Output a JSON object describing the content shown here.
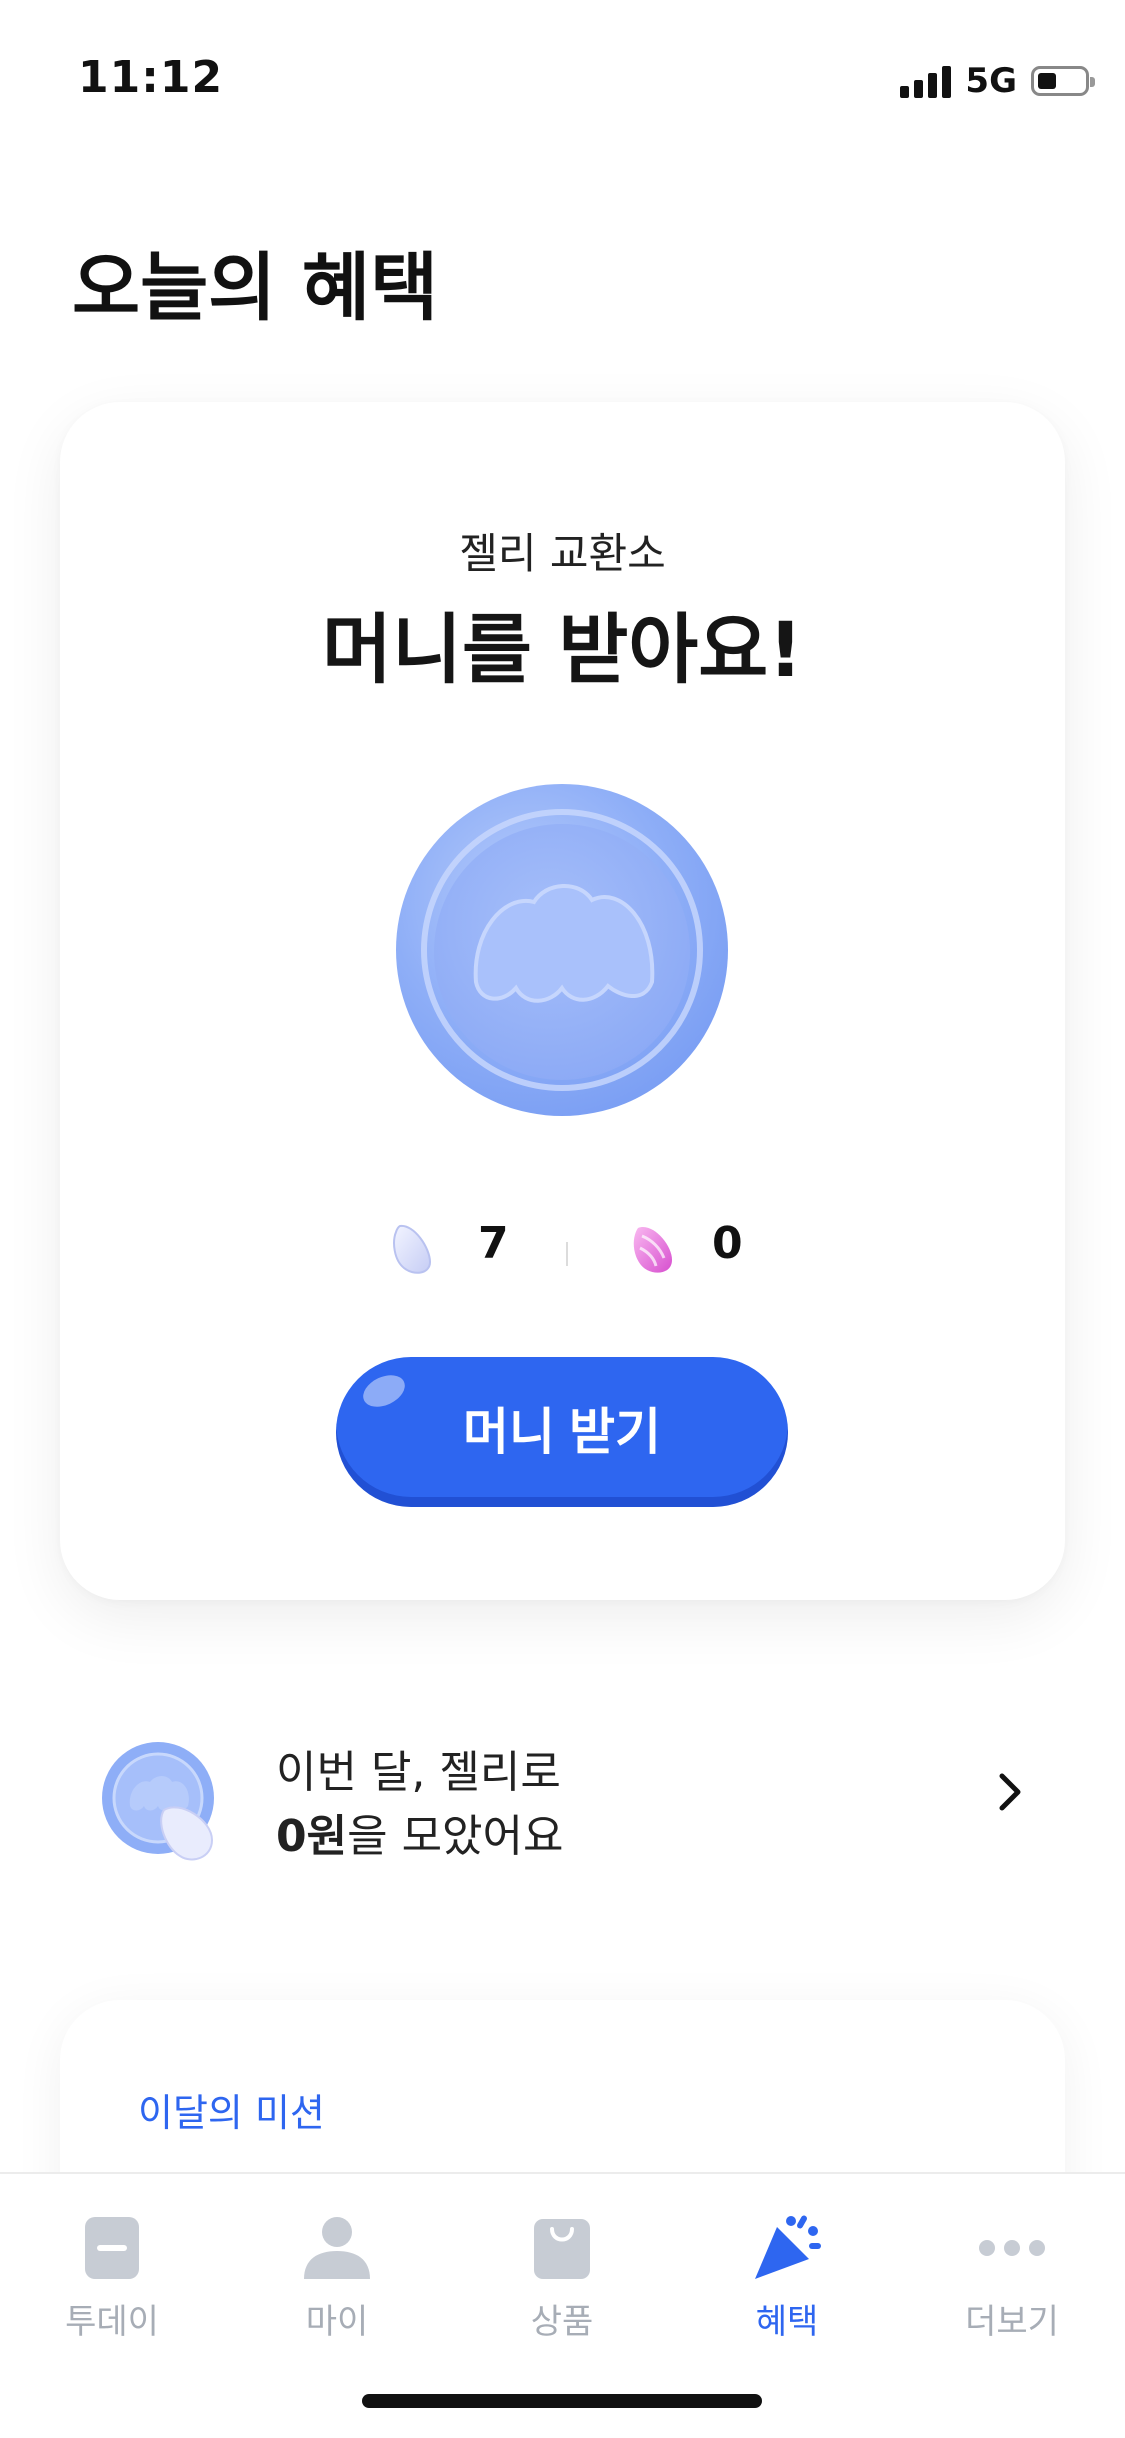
{
  "status_bar": {
    "time": "11:12",
    "network": "5G"
  },
  "page": {
    "title": "오늘의 혜택"
  },
  "main_card": {
    "subtitle": "젤리 교환소",
    "title": "머니를 받아요!",
    "jelly_white_count": "7",
    "jelly_pink_count": "0",
    "button_label": "머니 받기"
  },
  "summary": {
    "line1": "이번 달, 젤리로",
    "amount": "0원",
    "line2_suffix": "을 모았어요"
  },
  "mission": {
    "label": "이달의 미션"
  },
  "tabs": [
    {
      "label": "투데이",
      "icon": "today-icon",
      "active": false
    },
    {
      "label": "마이",
      "icon": "profile-icon",
      "active": false
    },
    {
      "label": "상품",
      "icon": "shopping-bag-icon",
      "active": false
    },
    {
      "label": "혜택",
      "icon": "party-popper-icon",
      "active": true
    },
    {
      "label": "더보기",
      "icon": "more-icon",
      "active": false
    }
  ],
  "colors": {
    "accent": "#2e66f0",
    "inactive_tab": "#a7adb6",
    "coin": "#8fb0f8"
  }
}
